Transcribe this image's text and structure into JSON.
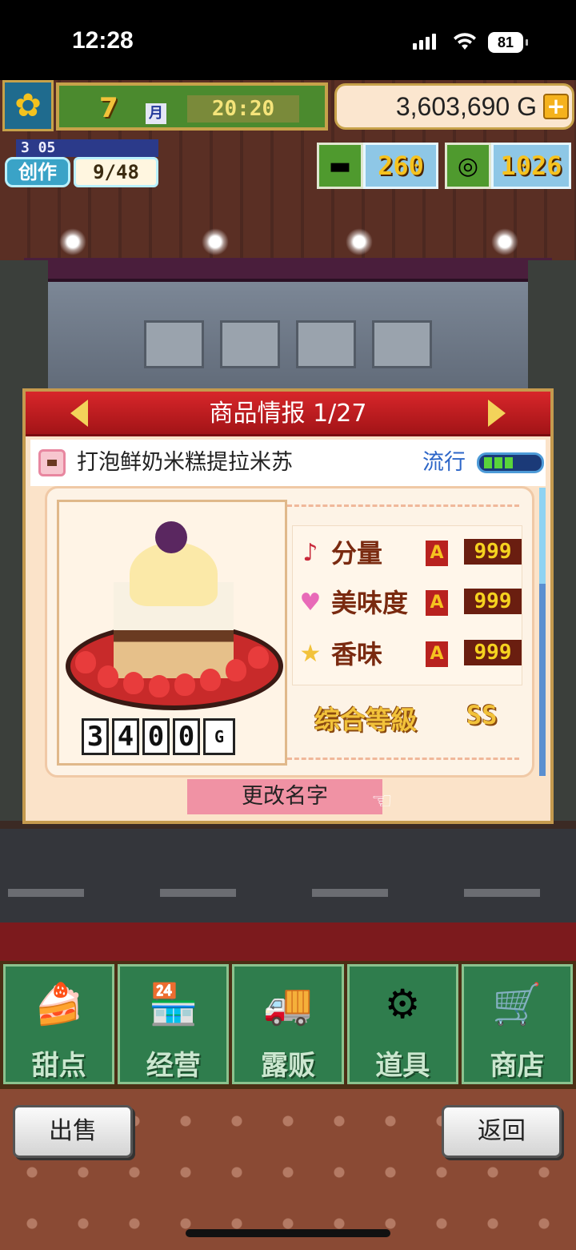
{
  "status_bar": {
    "time": "12:28",
    "battery": "81"
  },
  "hud": {
    "month_num": "7",
    "month_char": "月",
    "clock": "20:20",
    "money": "3,603,690 G",
    "money_plus": "+",
    "create_level": "3 05",
    "create_label": "创作",
    "create_count": "9/48",
    "gold_bars": "260",
    "medals": "1026"
  },
  "panel": {
    "title": "商品情报 1/27",
    "item_name": "打泡鲜奶米糕提拉米苏",
    "trend_label": "流行",
    "trend_level": 0.5,
    "price_digits": [
      "3",
      "4",
      "0",
      "0"
    ],
    "price_unit": "G",
    "stats": [
      {
        "icon": "music-note-icon",
        "glyph": "♪",
        "label": "分量",
        "rank": "A",
        "value": "999"
      },
      {
        "icon": "heart-icon",
        "glyph": "♥",
        "label": "美味度",
        "rank": "A",
        "value": "999"
      },
      {
        "icon": "star-icon",
        "glyph": "★",
        "label": "香味",
        "rank": "A",
        "value": "999"
      }
    ],
    "overall_label": "综合等級",
    "overall_value": "SS",
    "rename_label": "更改名字"
  },
  "nav": [
    {
      "label": "甜点",
      "icon": "cake-icon"
    },
    {
      "label": "经营",
      "icon": "shop-icon"
    },
    {
      "label": "露贩",
      "icon": "food-truck-icon"
    },
    {
      "label": "道具",
      "icon": "items-icon"
    },
    {
      "label": "商店",
      "icon": "cart-icon"
    }
  ],
  "footer": {
    "sell_label": "出售",
    "back_label": "返回"
  },
  "colors": {
    "panel_header": "#d8262a",
    "nav_green": "#2f7d4d",
    "accent_gold": "#f2c23a"
  }
}
